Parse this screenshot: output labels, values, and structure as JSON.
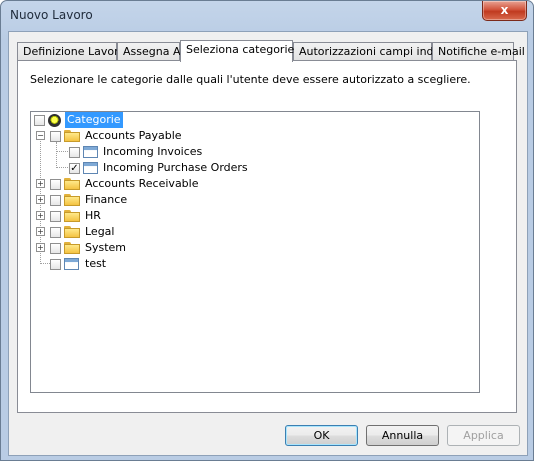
{
  "window": {
    "title": "Nuovo Lavoro",
    "close_glyph": "x"
  },
  "tabs": [
    {
      "label": "Definizione Lavoro",
      "active": false
    },
    {
      "label": "Assegna A",
      "active": false
    },
    {
      "label": "Seleziona categorie",
      "active": true
    },
    {
      "label": "Autorizzazioni campi indice",
      "active": false
    },
    {
      "label": "Notifiche e-mail",
      "active": false
    }
  ],
  "panel": {
    "instruction": "Selezionare le categorie dalle quali l'utente deve essere autorizzato a scegliere."
  },
  "tree": {
    "root": {
      "label": "Categorie",
      "checked": false,
      "selected": true,
      "icon": "root-category-icon"
    },
    "items": [
      {
        "label": "Accounts Payable",
        "expander": "−",
        "checked": false,
        "icon": "folder-icon"
      },
      {
        "label": "Incoming Invoices",
        "checked": false,
        "icon": "category-leaf-icon"
      },
      {
        "label": "Incoming Purchase Orders",
        "checked": true,
        "check_glyph": "✓",
        "icon": "category-leaf-icon"
      },
      {
        "label": "Accounts Receivable",
        "expander": "+",
        "checked": false,
        "icon": "folder-icon"
      },
      {
        "label": "Finance",
        "expander": "+",
        "checked": false,
        "icon": "folder-icon"
      },
      {
        "label": "HR",
        "expander": "+",
        "checked": false,
        "icon": "folder-icon"
      },
      {
        "label": "Legal",
        "expander": "+",
        "checked": false,
        "icon": "folder-icon"
      },
      {
        "label": "System",
        "expander": "+",
        "checked": false,
        "icon": "folder-icon"
      },
      {
        "label": "test",
        "checked": false,
        "icon": "category-leaf-icon"
      }
    ]
  },
  "buttons": {
    "ok": "OK",
    "cancel": "Annulla",
    "apply": "Applica"
  },
  "colors": {
    "selection": "#3399ff",
    "close_button": "#c03a1f",
    "window_frame": "#b9cce4"
  }
}
